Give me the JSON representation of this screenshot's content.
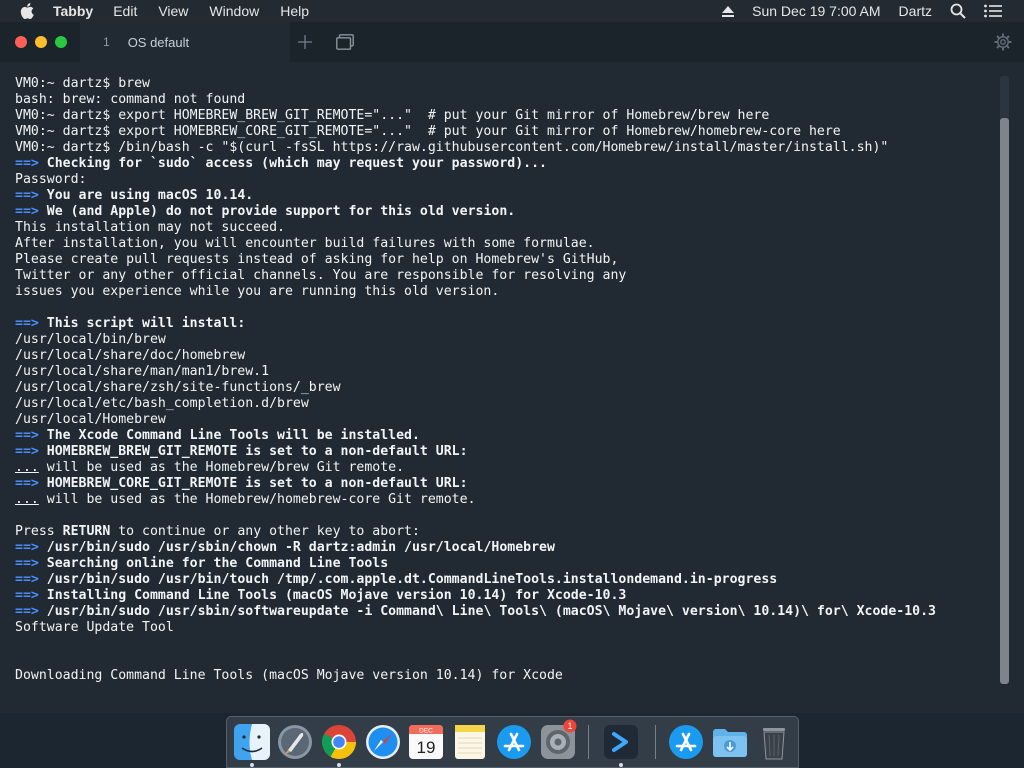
{
  "menubar": {
    "app_name": "Tabby",
    "menus": [
      "Edit",
      "View",
      "Window",
      "Help"
    ],
    "datetime": "Sun Dec 19  7:00 AM",
    "user": "Dartz"
  },
  "tab": {
    "index": "1",
    "title": "OS default"
  },
  "terminal": {
    "lines": [
      [
        {
          "t": "VM0:~ dartz$ brew"
        }
      ],
      [
        {
          "t": "bash: brew: command not found"
        }
      ],
      [
        {
          "t": "VM0:~ dartz$ export HOMEBREW_BREW_GIT_REMOTE=\"...\"  # put your Git mirror of Homebrew/brew here"
        }
      ],
      [
        {
          "t": "VM0:~ dartz$ export HOMEBREW_CORE_GIT_REMOTE=\"...\"  # put your Git mirror of Homebrew/homebrew-core here"
        }
      ],
      [
        {
          "t": "VM0:~ dartz$ /bin/bash -c \"$(curl -fsSL https://raw.githubusercontent.com/Homebrew/install/master/install.sh)\""
        }
      ],
      [
        {
          "t": "==>",
          "s": "marker"
        },
        {
          "t": " Checking for `sudo` access (which may request your password)...",
          "s": "bold"
        }
      ],
      [
        {
          "t": "Password:"
        }
      ],
      [
        {
          "t": "==>",
          "s": "marker"
        },
        {
          "t": " You are using macOS 10.14.",
          "s": "bold"
        }
      ],
      [
        {
          "t": "==>",
          "s": "marker"
        },
        {
          "t": " We (and Apple) do not provide support for this old version.",
          "s": "bold"
        }
      ],
      [
        {
          "t": "This installation may not succeed."
        }
      ],
      [
        {
          "t": "After installation, you will encounter build failures with some formulae."
        }
      ],
      [
        {
          "t": "Please create pull requests instead of asking for help on Homebrew's GitHub,"
        }
      ],
      [
        {
          "t": "Twitter or any other official channels. You are responsible for resolving any"
        }
      ],
      [
        {
          "t": "issues you experience while you are running this old version."
        }
      ],
      [
        {
          "t": ""
        }
      ],
      [
        {
          "t": "==>",
          "s": "marker"
        },
        {
          "t": " This script will install:",
          "s": "bold"
        }
      ],
      [
        {
          "t": "/usr/local/bin/brew"
        }
      ],
      [
        {
          "t": "/usr/local/share/doc/homebrew"
        }
      ],
      [
        {
          "t": "/usr/local/share/man/man1/brew.1"
        }
      ],
      [
        {
          "t": "/usr/local/share/zsh/site-functions/_brew"
        }
      ],
      [
        {
          "t": "/usr/local/etc/bash_completion.d/brew"
        }
      ],
      [
        {
          "t": "/usr/local/Homebrew"
        }
      ],
      [
        {
          "t": "==>",
          "s": "marker"
        },
        {
          "t": " The Xcode Command Line Tools will be installed.",
          "s": "bold"
        }
      ],
      [
        {
          "t": "==>",
          "s": "marker"
        },
        {
          "t": " HOMEBREW_BREW_GIT_REMOTE is set to a non-default URL:",
          "s": "bold"
        }
      ],
      [
        {
          "t": "...",
          "s": "ul"
        },
        {
          "t": " will be used as the Homebrew/brew Git remote."
        }
      ],
      [
        {
          "t": "==>",
          "s": "marker"
        },
        {
          "t": " HOMEBREW_CORE_GIT_REMOTE is set to a non-default URL:",
          "s": "bold"
        }
      ],
      [
        {
          "t": "...",
          "s": "ul"
        },
        {
          "t": " will be used as the Homebrew/homebrew-core Git remote."
        }
      ],
      [
        {
          "t": ""
        }
      ],
      [
        {
          "t": "Press "
        },
        {
          "t": "RETURN",
          "s": "bold"
        },
        {
          "t": " to continue or any other key to abort:"
        }
      ],
      [
        {
          "t": "==>",
          "s": "marker"
        },
        {
          "t": " /usr/bin/sudo /usr/sbin/chown -R dartz:admin /usr/local/Homebrew",
          "s": "bold"
        }
      ],
      [
        {
          "t": "==>",
          "s": "marker"
        },
        {
          "t": " Searching online for the Command Line Tools",
          "s": "bold"
        }
      ],
      [
        {
          "t": "==>",
          "s": "marker"
        },
        {
          "t": " /usr/bin/sudo /usr/bin/touch /tmp/.com.apple.dt.CommandLineTools.installondemand.in-progress",
          "s": "bold"
        }
      ],
      [
        {
          "t": "==>",
          "s": "marker"
        },
        {
          "t": " Installing Command Line Tools (macOS Mojave version 10.14) for Xcode-10.3",
          "s": "bold"
        }
      ],
      [
        {
          "t": "==>",
          "s": "marker"
        },
        {
          "t": " /usr/bin/sudo /usr/sbin/softwareupdate -i Command\\ Line\\ Tools\\ (macOS\\ Mojave\\ version\\ 10.14)\\ for\\ Xcode-10.3",
          "s": "bold"
        }
      ],
      [
        {
          "t": "Software Update Tool"
        }
      ],
      [
        {
          "t": ""
        }
      ],
      [
        {
          "t": ""
        }
      ],
      [
        {
          "t": "Downloading Command Line Tools (macOS Mojave version 10.14) for Xcode"
        }
      ]
    ]
  },
  "dock": {
    "apps": [
      {
        "name": "finder-icon",
        "running": true
      },
      {
        "name": "launchpad-icon",
        "running": false
      },
      {
        "name": "chrome-icon",
        "running": true
      },
      {
        "name": "safari-icon",
        "running": false
      },
      {
        "name": "calendar-icon",
        "running": false,
        "label_month": "DEC",
        "label_day": "19"
      },
      {
        "name": "notes-icon",
        "running": false
      },
      {
        "name": "app-store-icon",
        "running": false
      },
      {
        "name": "system-preferences-icon",
        "running": false,
        "badge": "1"
      },
      {
        "name": "tabby-icon",
        "running": true
      },
      {
        "name": "app-store-downloads-icon",
        "running": false
      },
      {
        "name": "downloads-folder-icon",
        "running": false
      },
      {
        "name": "trash-icon",
        "running": false
      }
    ]
  },
  "colors": {
    "prompt_marker": "#4a8dff",
    "terminal_bg": "#212a33",
    "titlebar_bg": "#1b232b",
    "menubar_bg": "#232a31"
  }
}
